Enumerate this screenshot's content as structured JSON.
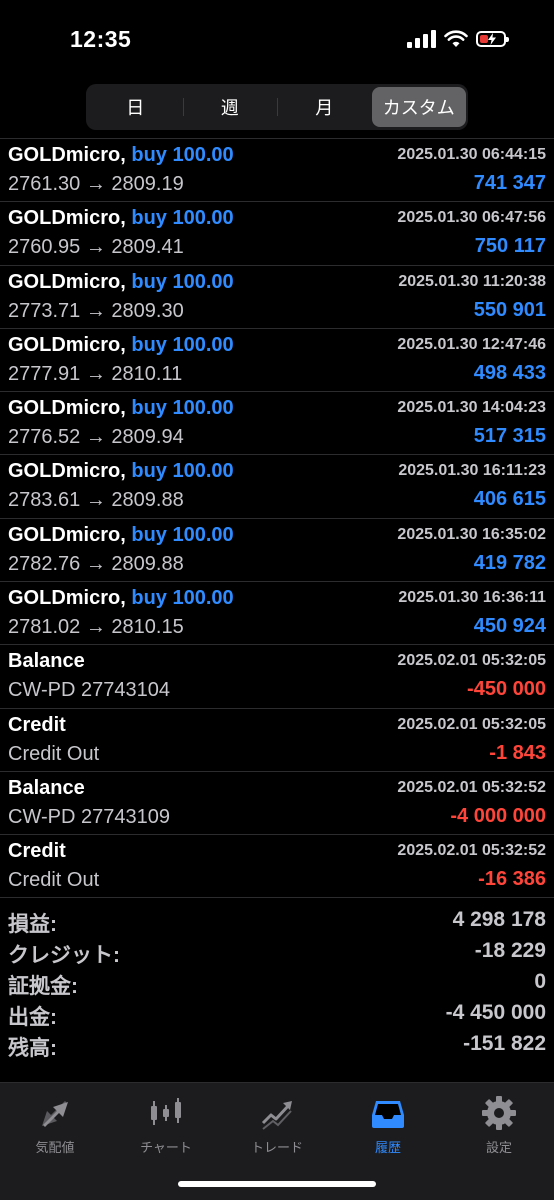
{
  "status": {
    "time": "12:35"
  },
  "segments": [
    {
      "label": "日"
    },
    {
      "label": "週"
    },
    {
      "label": "月"
    },
    {
      "label": "カスタム"
    }
  ],
  "rows": [
    {
      "symbol": "GOLDmicro,",
      "action": "buy 100.00",
      "time": "2025.01.30 06:44:15",
      "desc": "2761.30 → 2809.19",
      "amount": "741 347",
      "sign": "pos"
    },
    {
      "symbol": "GOLDmicro,",
      "action": "buy 100.00",
      "time": "2025.01.30 06:47:56",
      "desc": "2760.95 → 2809.41",
      "amount": "750 117",
      "sign": "pos"
    },
    {
      "symbol": "GOLDmicro,",
      "action": "buy 100.00",
      "time": "2025.01.30 11:20:38",
      "desc": "2773.71 → 2809.30",
      "amount": "550 901",
      "sign": "pos"
    },
    {
      "symbol": "GOLDmicro,",
      "action": "buy 100.00",
      "time": "2025.01.30 12:47:46",
      "desc": "2777.91 → 2810.11",
      "amount": "498 433",
      "sign": "pos"
    },
    {
      "symbol": "GOLDmicro,",
      "action": "buy 100.00",
      "time": "2025.01.30 14:04:23",
      "desc": "2776.52 → 2809.94",
      "amount": "517 315",
      "sign": "pos"
    },
    {
      "symbol": "GOLDmicro,",
      "action": "buy 100.00",
      "time": "2025.01.30 16:11:23",
      "desc": "2783.61 → 2809.88",
      "amount": "406 615",
      "sign": "pos"
    },
    {
      "symbol": "GOLDmicro,",
      "action": "buy 100.00",
      "time": "2025.01.30 16:35:02",
      "desc": "2782.76 → 2809.88",
      "amount": "419 782",
      "sign": "pos"
    },
    {
      "symbol": "GOLDmicro,",
      "action": "buy 100.00",
      "time": "2025.01.30 16:36:11",
      "desc": "2781.02 → 2810.15",
      "amount": "450 924",
      "sign": "pos"
    },
    {
      "symbol": "Balance",
      "action": "",
      "time": "2025.02.01 05:32:05",
      "desc": "CW-PD 27743104",
      "amount": "-450 000",
      "sign": "neg"
    },
    {
      "symbol": "Credit",
      "action": "",
      "time": "2025.02.01 05:32:05",
      "desc": "Credit Out",
      "amount": "-1 843",
      "sign": "neg"
    },
    {
      "symbol": "Balance",
      "action": "",
      "time": "2025.02.01 05:32:52",
      "desc": "CW-PD 27743109",
      "amount": "-4 000 000",
      "sign": "neg"
    },
    {
      "symbol": "Credit",
      "action": "",
      "time": "2025.02.01 05:32:52",
      "desc": "Credit Out",
      "amount": "-16 386",
      "sign": "neg"
    }
  ],
  "summary": [
    {
      "label": "損益:",
      "value": "4 298 178"
    },
    {
      "label": "クレジット:",
      "value": "-18 229"
    },
    {
      "label": "証拠金:",
      "value": "0"
    },
    {
      "label": "出金:",
      "value": "-4 450 000"
    },
    {
      "label": "残高:",
      "value": "-151 822"
    }
  ],
  "tabs": [
    {
      "label": "気配値",
      "icon": "quotes-icon"
    },
    {
      "label": "チャート",
      "icon": "chart-icon"
    },
    {
      "label": "トレード",
      "icon": "trade-icon"
    },
    {
      "label": "履歴",
      "icon": "history-icon",
      "active": true
    },
    {
      "label": "設定",
      "icon": "settings-icon"
    }
  ],
  "colors": {
    "accent": "#2f8bff",
    "negative": "#ff453a",
    "background": "#000000"
  }
}
